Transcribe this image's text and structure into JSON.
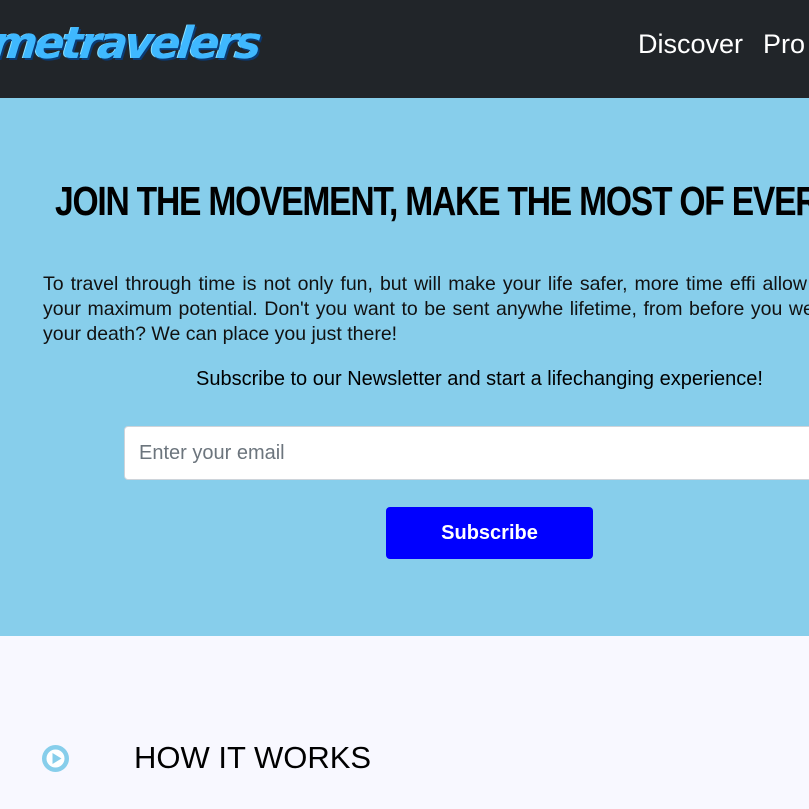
{
  "navbar": {
    "logo_text": "metravelers",
    "links": [
      {
        "label": "Discover"
      },
      {
        "label": "Pro"
      }
    ]
  },
  "hero": {
    "title": "JOIN THE MOVEMENT, MAKE THE MOST OF EVERY M",
    "paragraph": "To travel through time is not only fun, but will make your life safer, more time effi allow you to achieve your maximum potential. Don't you want to be sent anywhe lifetime, from before you were born to past your death? We can place you just there!",
    "newsletter_caption": "Subscribe to our Newsletter and start a lifechanging experience!",
    "email_placeholder": "Enter your email",
    "email_value": "",
    "subscribe_label": "Subscribe"
  },
  "how_it_works": {
    "icon": "play-circle-icon",
    "title": "HOW IT WORKS"
  },
  "colors": {
    "navbar_bg": "#212529",
    "hero_bg": "#87ceeb",
    "subscribe_bg": "#0000ff",
    "section_bg": "#f8f8ff",
    "logo": "#3fb8ff"
  }
}
